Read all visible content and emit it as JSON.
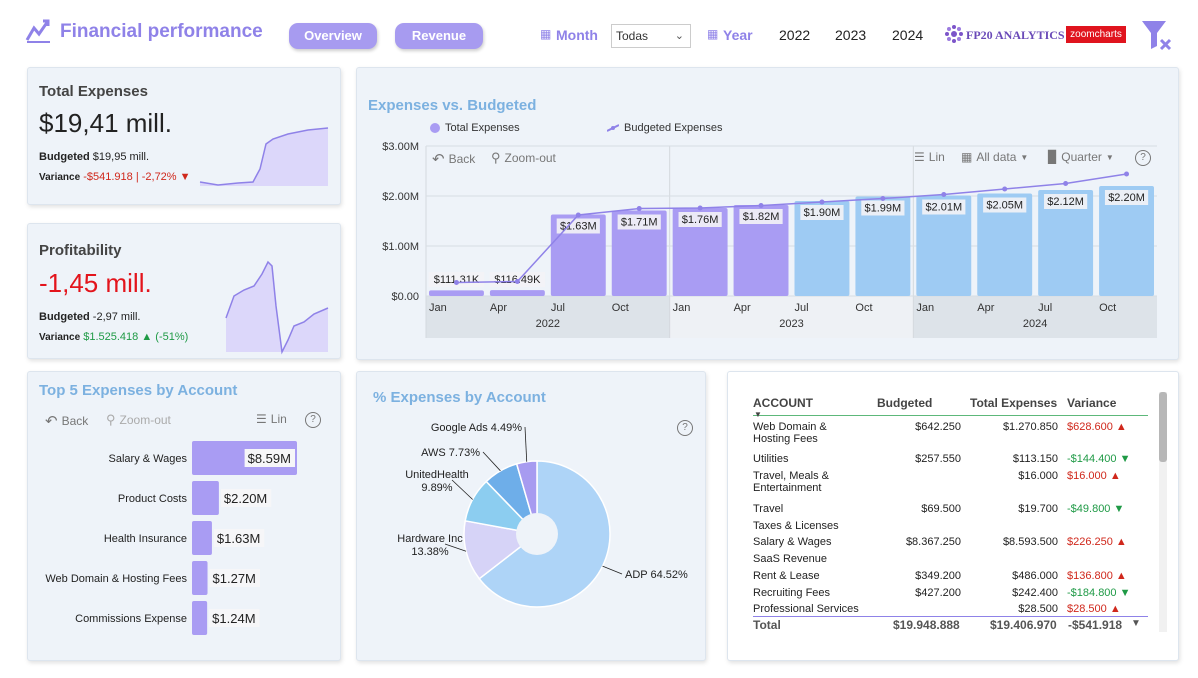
{
  "header": {
    "title": "Financial performance",
    "tabs": [
      "Overview",
      "Revenue"
    ],
    "month_label": "Month",
    "month_select": "Todas",
    "year_label": "Year",
    "years": [
      "2022",
      "2023",
      "2024"
    ],
    "brand1": "FP20 ANALYTICS",
    "brand2": "zoomcharts",
    "colors": {
      "accent": "#a79bf0",
      "bar_purple": "#a99cf3",
      "bar_blue": "#9ecbf3",
      "negative": "#d0281c",
      "positive": "#1f9a46"
    }
  },
  "kpi_expenses": {
    "title": "Total Expenses",
    "value": "$19,41 mill.",
    "budget_label": "Budgeted",
    "budget_value": "$19,95 mill.",
    "variance_label": "Variance",
    "variance_value": "-$541.918 | -2,72%"
  },
  "kpi_profit": {
    "title": "Profitability",
    "value": "-1,45 mill.",
    "budget_label": "Budgeted",
    "budget_value": "-2,97 mill.",
    "variance_label": "Variance",
    "variance_value": "$1.525.418",
    "variance_pct": "(-51%)"
  },
  "exp_vs_budget": {
    "title": "Expenses vs. Budgeted",
    "legend": [
      "Total Expenses",
      "Budgeted Expenses"
    ],
    "toolbar": {
      "back": "Back",
      "zoom": "Zoom-out",
      "lin": "Lin",
      "alldata": "All data",
      "quarter": "Quarter"
    }
  },
  "top5": {
    "title": "Top 5 Expenses by Account",
    "toolbar": {
      "back": "Back",
      "zoom": "Zoom-out",
      "lin": "Lin"
    }
  },
  "pie_card": {
    "title": "% Expenses by Account"
  },
  "table": {
    "headers": [
      "ACCOUNT",
      "Budgeted",
      "Total Expenses",
      "Variance"
    ],
    "rows": [
      {
        "account": "Web Domain & Hosting Fees",
        "budgeted": "$642.250",
        "total": "$1.270.850",
        "variance": "$628.600"
      },
      {
        "account": "Utilities",
        "budgeted": "$257.550",
        "total": "$113.150",
        "variance": "-$144.400"
      },
      {
        "account": "Travel, Meals & Entertainment",
        "budgeted": "",
        "total": "$16.000",
        "variance": "$16.000"
      },
      {
        "account": "Travel",
        "budgeted": "$69.500",
        "total": "$19.700",
        "variance": "-$49.800"
      },
      {
        "account": "Taxes & Licenses",
        "budgeted": "",
        "total": "",
        "variance": ""
      },
      {
        "account": "Salary & Wages",
        "budgeted": "$8.367.250",
        "total": "$8.593.500",
        "variance": "$226.250"
      },
      {
        "account": "SaaS Revenue",
        "budgeted": "",
        "total": "",
        "variance": ""
      },
      {
        "account": "Rent & Lease",
        "budgeted": "$349.200",
        "total": "$486.000",
        "variance": "$136.800"
      },
      {
        "account": "Recruiting Fees",
        "budgeted": "$427.200",
        "total": "$242.400",
        "variance": "-$184.800"
      },
      {
        "account": "Professional Services",
        "budgeted": "",
        "total": "$28.500",
        "variance": "$28.500"
      }
    ],
    "total": {
      "label": "Total",
      "budgeted": "$19.948.888",
      "total": "$19.406.970",
      "variance": "-$541.918"
    }
  },
  "chart_data": [
    {
      "type": "bar",
      "title": "Expenses vs. Budgeted",
      "categories": [
        "Jan 2022",
        "Apr 2022",
        "Jul 2022",
        "Oct 2022",
        "Jan 2023",
        "Apr 2023",
        "Jul 2023",
        "Oct 2023",
        "Jan 2024",
        "Apr 2024",
        "Jul 2024",
        "Oct 2024"
      ],
      "x_tick_labels": [
        "Jan",
        "Apr",
        "Jul",
        "Oct",
        "Jan",
        "Apr",
        "Jul",
        "Oct",
        "Jan",
        "Apr",
        "Jul",
        "Oct"
      ],
      "x_group_labels": [
        "2022",
        "2023",
        "2024"
      ],
      "y_tick_labels": [
        "$0.00",
        "$1.00M",
        "$2.00M",
        "$3.00M"
      ],
      "ylim": [
        0,
        3000000
      ],
      "series": [
        {
          "name": "Total Expenses",
          "values": [
            111310,
            116490,
            1630000,
            1710000,
            1760000,
            1820000,
            1900000,
            1990000,
            2010000,
            2050000,
            2120000,
            2200000
          ],
          "labels": [
            "$111.31K",
            "$116.49K",
            "$1.63M",
            "$1.71M",
            "$1.76M",
            "$1.82M",
            "$1.90M",
            "$1.99M",
            "$2.01M",
            "$2.05M",
            "$2.12M",
            "$2.20M"
          ]
        },
        {
          "name": "Budgeted Expenses",
          "values": [
            270000,
            290000,
            1620000,
            1750000,
            1760000,
            1810000,
            1880000,
            1950000,
            2030000,
            2140000,
            2250000,
            2440000
          ]
        }
      ]
    },
    {
      "type": "bar",
      "title": "Top 5 Expenses by Account",
      "categories": [
        "Salary & Wages",
        "Product Costs",
        "Health Insurance",
        "Web Domain & Hosting Fees",
        "Commissions Expense"
      ],
      "values": [
        8590000,
        2200000,
        1630000,
        1270000,
        1240000
      ],
      "labels": [
        "$8.59M",
        "$2.20M",
        "$1.63M",
        "$1.27M",
        "$1.24M"
      ]
    },
    {
      "type": "pie",
      "title": "% Expenses by Account",
      "categories": [
        "ADP",
        "Hardware Inc",
        "UnitedHealth",
        "AWS",
        "Google Ads"
      ],
      "values": [
        64.52,
        13.38,
        9.89,
        7.73,
        4.49
      ],
      "labels": [
        "ADP 64.52%",
        "Hardware Inc\n13.38%",
        "UnitedHealth\n9.89%",
        "AWS 7.73%",
        "Google Ads 4.49%"
      ],
      "colors": [
        "#aed4f7",
        "#d6d3f7",
        "#8ccdf0",
        "#6eaee9",
        "#a79bf0"
      ]
    }
  ]
}
